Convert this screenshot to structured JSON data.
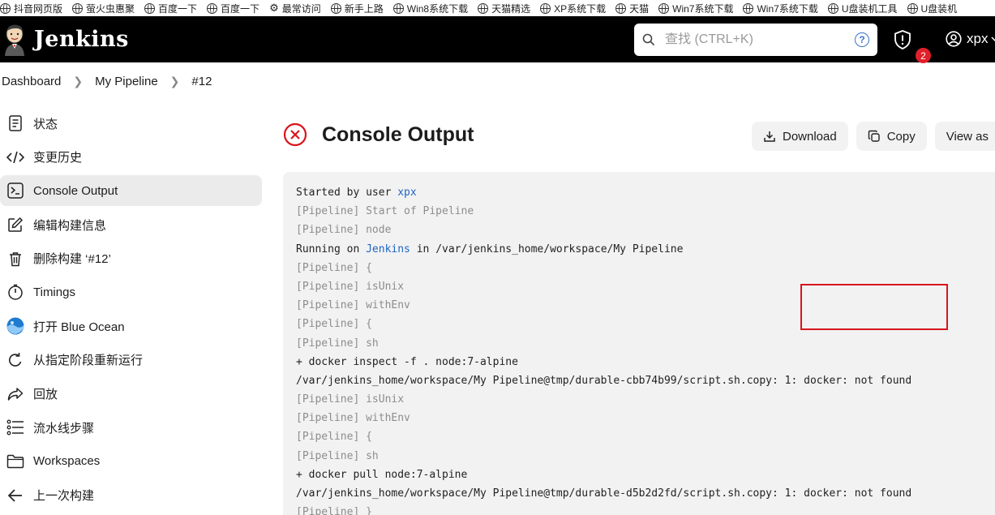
{
  "bookmarks": [
    "抖音网页版",
    "萤火虫惠聚",
    "百度一下",
    "百度一下",
    "最常访问",
    "新手上路",
    "Win8系统下载",
    "天猫精选",
    "XP系统下载",
    "天猫",
    "Win7系统下载",
    "Win7系统下载",
    "U盘装机工具",
    "U盘装机"
  ],
  "header": {
    "brand": "Jenkins",
    "search_placeholder": "查找 (CTRL+K)",
    "notification_count": "2",
    "user": "xpx"
  },
  "breadcrumb": [
    "Dashboard",
    "My Pipeline",
    "#12"
  ],
  "sidebar": {
    "items": [
      {
        "label": "状态",
        "icon": "document-icon"
      },
      {
        "label": "变更历史",
        "icon": "code-icon"
      },
      {
        "label": "Console Output",
        "icon": "terminal-icon",
        "active": true
      },
      {
        "label": "编辑构建信息",
        "icon": "edit-icon"
      },
      {
        "label": "删除构建 ‘#12’",
        "icon": "trash-icon"
      },
      {
        "label": "Timings",
        "icon": "timer-icon"
      },
      {
        "label": "打开 Blue Ocean",
        "icon": "blue-ocean-icon"
      },
      {
        "label": "从指定阶段重新运行",
        "icon": "rerun-icon"
      },
      {
        "label": "回放",
        "icon": "replay-icon"
      },
      {
        "label": "流水线步骤",
        "icon": "steps-icon"
      },
      {
        "label": "Workspaces",
        "icon": "folder-icon"
      },
      {
        "label": "上一次构建",
        "icon": "arrow-left-icon"
      }
    ]
  },
  "page": {
    "title": "Console Output",
    "status_color": "#d9151c",
    "download_label": "Download",
    "copy_label": "Copy",
    "view_label": "View as"
  },
  "console": {
    "lines": [
      {
        "t": "Started by user ",
        "link": "xpx",
        "after": "",
        "pl": false
      },
      {
        "t": "[Pipeline] Start of Pipeline",
        "pl": true
      },
      {
        "t": "[Pipeline] node",
        "pl": true
      },
      {
        "t": "Running on ",
        "link": "Jenkins",
        "after": " in /var/jenkins_home/workspace/My Pipeline",
        "pl": false
      },
      {
        "t": "[Pipeline] {",
        "pl": true
      },
      {
        "t": "[Pipeline] isUnix",
        "pl": true
      },
      {
        "t": "[Pipeline] withEnv",
        "pl": true
      },
      {
        "t": "[Pipeline] {",
        "pl": true
      },
      {
        "t": "[Pipeline] sh",
        "pl": true
      },
      {
        "t": "+ docker inspect -f . node:7-alpine",
        "pl": false
      },
      {
        "t": "/var/jenkins_home/workspace/My Pipeline@tmp/durable-cbb74b99/script.sh.copy: 1: docker: not found",
        "pl": false
      },
      {
        "t": "[Pipeline] isUnix",
        "pl": true
      },
      {
        "t": "[Pipeline] withEnv",
        "pl": true
      },
      {
        "t": "[Pipeline] {",
        "pl": true
      },
      {
        "t": "[Pipeline] sh",
        "pl": true
      },
      {
        "t": "+ docker pull node:7-alpine",
        "pl": false
      },
      {
        "t": "/var/jenkins_home/workspace/My Pipeline@tmp/durable-d5b2d2fd/script.sh.copy: 1: docker: not found",
        "pl": false
      },
      {
        "t": "[Pipeline] }",
        "pl": true
      }
    ]
  }
}
